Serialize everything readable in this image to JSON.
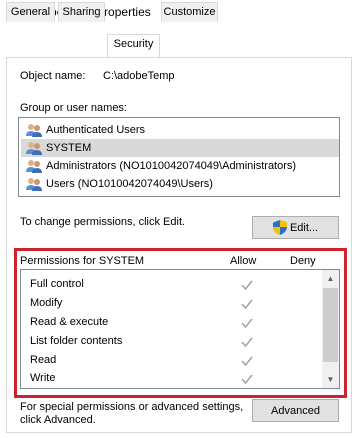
{
  "window": {
    "title": "adobeTemp Properties"
  },
  "tabs": [
    {
      "label": "General"
    },
    {
      "label": "Sharing"
    },
    {
      "label": "Security",
      "active": true
    },
    {
      "label": "Customize"
    }
  ],
  "object": {
    "label": "Object name:",
    "value": "C:\\adobeTemp"
  },
  "groups": {
    "label": "Group or user names:",
    "items": [
      {
        "label": "Authenticated Users"
      },
      {
        "label": "SYSTEM",
        "selected": true
      },
      {
        "label": "Administrators (NO1010042074049\\Administrators)"
      },
      {
        "label": "Users (NO1010042074049\\Users)"
      }
    ]
  },
  "edit": {
    "hint": "To change permissions, click Edit.",
    "button_label": "Edit..."
  },
  "permissions": {
    "title": "Permissions for SYSTEM",
    "allow_header": "Allow",
    "deny_header": "Deny",
    "rows": [
      {
        "name": "Full control",
        "allow": true
      },
      {
        "name": "Modify",
        "allow": true
      },
      {
        "name": "Read & execute",
        "allow": true
      },
      {
        "name": "List folder contents",
        "allow": true
      },
      {
        "name": "Read",
        "allow": true
      },
      {
        "name": "Write",
        "allow": true
      }
    ]
  },
  "advanced": {
    "hint_line1": "For special permissions or advanced settings,",
    "hint_line2": "click Advanced.",
    "button_label": "Advanced"
  },
  "colors": {
    "highlight": "#d0222c",
    "check": "#a0a0a0"
  }
}
